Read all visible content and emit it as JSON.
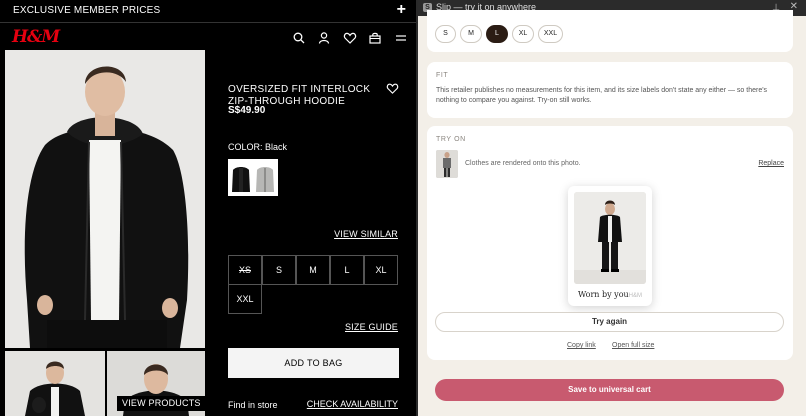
{
  "store": {
    "banner_text": "EXCLUSIVE MEMBER PRICES",
    "banner_plus": "+",
    "logo": "H&M",
    "product": {
      "title": "OVERSIZED FIT INTERLOCK ZIP-THROUGH HOODIE",
      "price": "S$49.90",
      "color_label": "COLOR: Black",
      "view_similar": "VIEW SIMILAR",
      "sizes": [
        {
          "label": "XS",
          "available": false
        },
        {
          "label": "S",
          "available": true
        },
        {
          "label": "M",
          "available": true
        },
        {
          "label": "L",
          "available": true
        },
        {
          "label": "XL",
          "available": true
        },
        {
          "label": "XXL",
          "available": true
        }
      ],
      "size_guide": "SIZE GUIDE",
      "add_to_bag": "ADD TO BAG",
      "find_in_store": "Find in store",
      "check_availability": "CHECK AVAILABILITY",
      "view_products": "VIEW PRODUCTS"
    }
  },
  "extension": {
    "window_title": "Slip — try it on anywhere",
    "icon_letter": "S",
    "pin_glyph": "⊥",
    "close_glyph": "✕",
    "sizes": [
      "S",
      "M",
      "L",
      "XL",
      "XXL"
    ],
    "selected_size": "L",
    "fit": {
      "kicker": "FIT",
      "text": "This retailer publishes no measurements for this item, and its size labels don't state any either — so there's nothing to compare you against. Try-on still works."
    },
    "try_on": {
      "kicker": "TRY ON",
      "note": "Clothes are rendered onto this photo.",
      "replace": "Replace",
      "worn_by": "Worn by you",
      "worn_brand": "H&M",
      "try_again": "Try again",
      "copy_link": "Copy link",
      "open_full_size": "Open full size"
    },
    "save_cart": "Save to universal cart"
  },
  "colors": {
    "store_bg": "#000000",
    "brand_red": "#e50010",
    "ext_bg": "#f3efe8",
    "selected_size": "#2b1c14",
    "save_button": "#c85a6f"
  },
  "icons": [
    "plus-icon",
    "search-icon",
    "account-icon",
    "heart-icon",
    "bag-icon",
    "menu-icon",
    "pin-icon",
    "close-icon"
  ]
}
